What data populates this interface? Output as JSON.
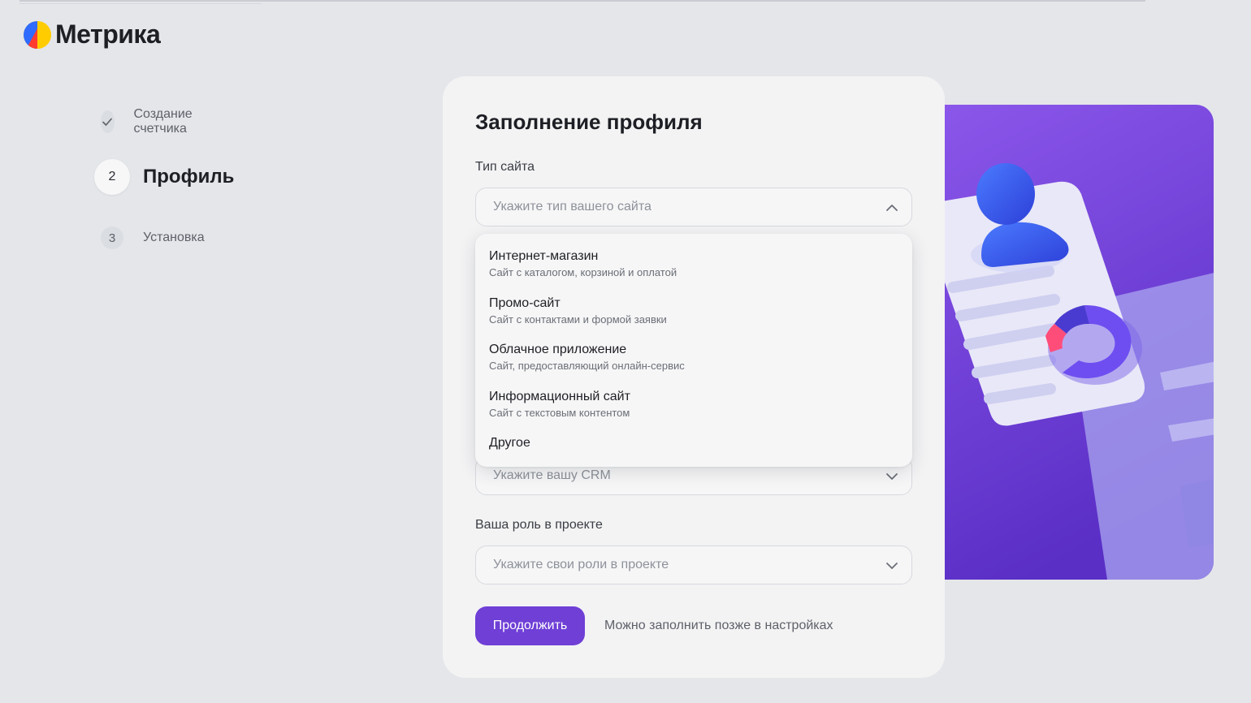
{
  "logo": {
    "text": "Метрика"
  },
  "steps": [
    {
      "number": "",
      "label": "Создание счетчика",
      "state": "done"
    },
    {
      "number": "2",
      "label": "Профиль",
      "state": "active"
    },
    {
      "number": "3",
      "label": "Установка",
      "state": "pending"
    }
  ],
  "form": {
    "title": "Заполнение профиля",
    "site_type": {
      "label": "Тип сайта",
      "placeholder": "Укажите тип вашего сайта"
    },
    "crm": {
      "placeholder": "Укажите вашу CRM"
    },
    "role": {
      "label": "Ваша роль в проекте",
      "placeholder": "Укажите свои роли в проекте"
    },
    "continue_label": "Продолжить",
    "later_note": "Можно заполнить позже в настройках"
  },
  "dropdown": {
    "options": [
      {
        "title": "Интернет-магазин",
        "description": "Сайт с каталогом, корзиной и оплатой"
      },
      {
        "title": "Промо-сайт",
        "description": "Сайт с контактами и формой заявки"
      },
      {
        "title": "Облачное приложение",
        "description": "Сайт, предоставляющий онлайн-сервис"
      },
      {
        "title": "Информационный сайт",
        "description": "Сайт с текстовым контентом"
      },
      {
        "title": "Другое",
        "description": ""
      }
    ]
  },
  "colors": {
    "accent": "#6f3fd6",
    "background": "#e4e6ea",
    "card": "#f3f3f4"
  },
  "icons": [
    "metrika-logo-icon",
    "check-icon",
    "chevron-up-icon",
    "chevron-down-icon"
  ]
}
